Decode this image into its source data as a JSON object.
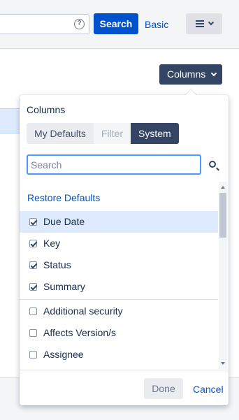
{
  "toolbar": {
    "search_label": "Search",
    "basic_label": "Basic",
    "help_glyph": "?",
    "help_icon": "question-circle-icon",
    "menu_icon": "hamburger-icon"
  },
  "columns_button": {
    "label": "Columns"
  },
  "panel": {
    "title": "Columns",
    "tabs": [
      {
        "label": "My Defaults",
        "state": "enabled"
      },
      {
        "label": "Filter",
        "state": "disabled"
      },
      {
        "label": "System",
        "state": "selected"
      }
    ],
    "search": {
      "placeholder": "Search",
      "value": ""
    },
    "restore_label": "Restore Defaults",
    "checked_items": [
      {
        "label": "Due Date",
        "checked": true,
        "highlighted": true
      },
      {
        "label": "Key",
        "checked": true
      },
      {
        "label": "Status",
        "checked": true
      },
      {
        "label": "Summary",
        "checked": true
      }
    ],
    "unchecked_items": [
      {
        "label": "Additional security",
        "checked": false
      },
      {
        "label": "Affects Version/s",
        "checked": false
      },
      {
        "label": "Assignee",
        "checked": false
      }
    ],
    "done_label": "Done",
    "cancel_label": "Cancel"
  },
  "colors": {
    "accent_blue": "#0052cc",
    "dark_button": "#344563",
    "focus_border": "#4c9aff",
    "selected_row": "#deebff"
  }
}
